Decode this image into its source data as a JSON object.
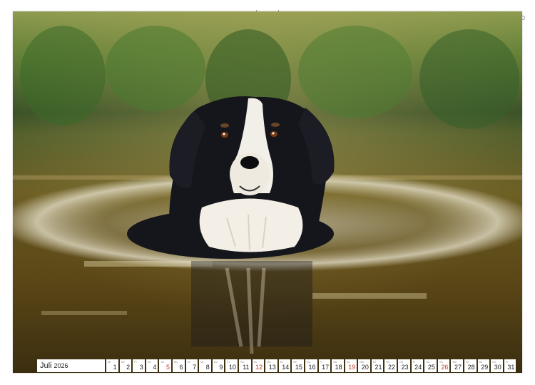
{
  "calendar": {
    "month": "Juli",
    "year": "2026",
    "days": [
      {
        "n": "1",
        "wd": "Mi"
      },
      {
        "n": "2",
        "wd": "Do"
      },
      {
        "n": "3",
        "wd": "Fr"
      },
      {
        "n": "4",
        "wd": "Sa"
      },
      {
        "n": "5",
        "wd": "So",
        "sun": true
      },
      {
        "n": "6",
        "wd": "Mo"
      },
      {
        "n": "7",
        "wd": "Di"
      },
      {
        "n": "8",
        "wd": "Mi"
      },
      {
        "n": "9",
        "wd": "Do"
      },
      {
        "n": "10",
        "wd": "Fr"
      },
      {
        "n": "11",
        "wd": "Sa"
      },
      {
        "n": "12",
        "wd": "So",
        "sun": true
      },
      {
        "n": "13",
        "wd": "Mo"
      },
      {
        "n": "14",
        "wd": "Di"
      },
      {
        "n": "15",
        "wd": "Mi"
      },
      {
        "n": "16",
        "wd": "Do"
      },
      {
        "n": "17",
        "wd": "Fr"
      },
      {
        "n": "18",
        "wd": "Sa"
      },
      {
        "n": "19",
        "wd": "So",
        "sun": true
      },
      {
        "n": "20",
        "wd": "Mo"
      },
      {
        "n": "21",
        "wd": "Di"
      },
      {
        "n": "22",
        "wd": "Mi"
      },
      {
        "n": "23",
        "wd": "Do"
      },
      {
        "n": "24",
        "wd": "Fr"
      },
      {
        "n": "25",
        "wd": "Sa"
      },
      {
        "n": "26",
        "wd": "So",
        "sun": true
      },
      {
        "n": "27",
        "wd": "Mo"
      },
      {
        "n": "28",
        "wd": "Di"
      },
      {
        "n": "29",
        "wd": "Mi"
      },
      {
        "n": "30",
        "wd": "Do"
      },
      {
        "n": "31",
        "wd": "Fr"
      }
    ]
  },
  "colors": {
    "sunday": "#c0392b",
    "water": "#6b5418",
    "reeds": "#3f6a2a",
    "dog_fur": "#15151c"
  },
  "image": {
    "subject": "black-and-white dog swimming in a pond"
  }
}
